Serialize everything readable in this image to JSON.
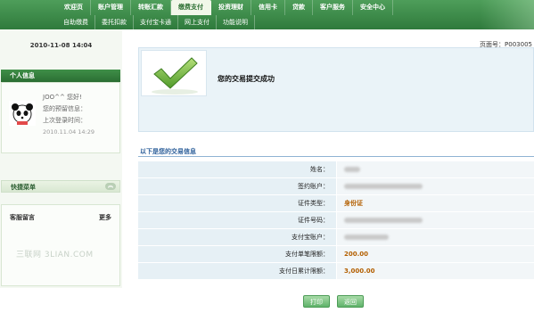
{
  "nav": {
    "main": [
      "欢迎页",
      "账户管理",
      "转账汇款",
      "缴费支付",
      "投资理财",
      "信用卡",
      "贷款",
      "客户服务",
      "安全中心"
    ],
    "active_index": 3,
    "sub": [
      "自助缴费",
      "委托扣款",
      "支付宝卡通",
      "网上支付",
      "功能说明"
    ]
  },
  "sidebar": {
    "date": "2010-11-08  14:04",
    "user_box_title": "个人信息",
    "greeting": "JOO^^ 您好!",
    "reserved_info": "您的预留信息：",
    "last_login_label": "上次登录时间：",
    "last_login_time": "2010.11.04 14:29",
    "quick_menu": "快捷菜单",
    "collapse_glyph": "︽",
    "service_title": "客服留言",
    "service_more": "更多"
  },
  "main": {
    "page_no": "页面号：P003005",
    "success_text": "您的交易提交成功",
    "info_title": "以下是您的交易信息",
    "rows": [
      {
        "label": "姓名：",
        "value": "",
        "mask": true,
        "mask_size": "short"
      },
      {
        "label": "签约账户：",
        "value": "",
        "mask": true,
        "mask_size": "long"
      },
      {
        "label": "证件类型：",
        "value": "身份证",
        "mask": false
      },
      {
        "label": "证件号码：",
        "value": "",
        "mask": true,
        "mask_size": "long"
      },
      {
        "label": "支付宝账户：",
        "value": "",
        "mask": true,
        "mask_size": "medium"
      },
      {
        "label": "支付单笔限额：",
        "value": "200.00",
        "mask": false
      },
      {
        "label": "支付日累计限额：",
        "value": "3,000.00",
        "mask": false
      }
    ],
    "print_button": "打印",
    "back_button": "返回"
  },
  "watermark": "三联网 3LIAN.COM",
  "colors": {
    "nav_green": "#2f7a3c",
    "value_orange": "#b35f00",
    "title_blue": "#2d5f9a"
  }
}
